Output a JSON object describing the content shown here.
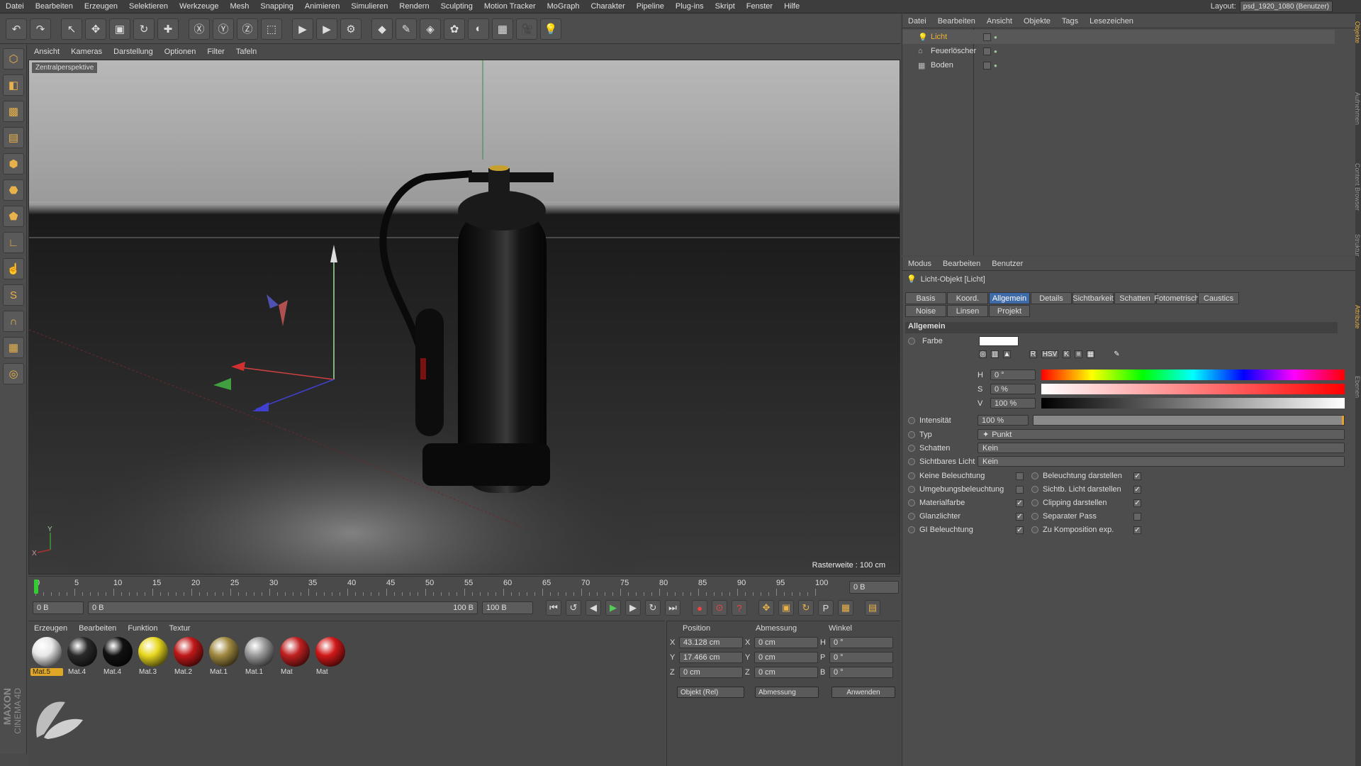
{
  "menu": [
    "Datei",
    "Bearbeiten",
    "Erzeugen",
    "Selektieren",
    "Werkzeuge",
    "Mesh",
    "Snapping",
    "Animieren",
    "Simulieren",
    "Rendern",
    "Sculpting",
    "Motion Tracker",
    "MoGraph",
    "Charakter",
    "Pipeline",
    "Plug-ins",
    "Skript",
    "Fenster",
    "Hilfe"
  ],
  "layout": {
    "label": "Layout:",
    "value": "psd_1920_1080 (Benutzer)"
  },
  "viewport": {
    "menu": [
      "Ansicht",
      "Kameras",
      "Darstellung",
      "Optionen",
      "Filter",
      "Tafeln"
    ],
    "tag": "Zentralperspektive",
    "raster": "Rasterweite : 100 cm",
    "axis_x": "X",
    "axis_y": "Y"
  },
  "timeline": {
    "marks": [
      "0",
      "5",
      "10",
      "15",
      "20",
      "25",
      "30",
      "35",
      "40",
      "45",
      "50",
      "55",
      "60",
      "65",
      "70",
      "75",
      "80",
      "85",
      "90",
      "95",
      "100"
    ],
    "current_frame": "0 B",
    "start": "0 B",
    "range_start": "0 B",
    "range_end": "100 B",
    "end": "100 B"
  },
  "materials": {
    "menu": [
      "Erzeugen",
      "Bearbeiten",
      "Funktion",
      "Textur"
    ],
    "items": [
      {
        "label": "Mat.5",
        "color": "#e8e8e8",
        "selected": true
      },
      {
        "label": "Mat.4",
        "color": "#2a2a2a",
        "selected": false
      },
      {
        "label": "Mat.4",
        "color": "#111111",
        "selected": false
      },
      {
        "label": "Mat.3",
        "color": "#e8d820",
        "selected": false
      },
      {
        "label": "Mat.2",
        "color": "#c01818",
        "selected": false
      },
      {
        "label": "Mat.1",
        "color": "#a08a40",
        "selected": false
      },
      {
        "label": "Mat.1",
        "color": "#9a9a9a",
        "selected": false
      },
      {
        "label": "Mat",
        "color": "#c02020",
        "selected": false
      },
      {
        "label": "Mat",
        "color": "#d01818",
        "selected": false
      }
    ]
  },
  "coords": {
    "headers": [
      "Position",
      "Abmessung",
      "Winkel"
    ],
    "rows": [
      {
        "axis": "X",
        "pos": "43.128 cm",
        "dim_axis": "X",
        "dim": "0 cm",
        "ang_axis": "H",
        "ang": "0 °"
      },
      {
        "axis": "Y",
        "pos": "17.466 cm",
        "dim_axis": "Y",
        "dim": "0 cm",
        "ang_axis": "P",
        "ang": "0 °"
      },
      {
        "axis": "Z",
        "pos": "0 cm",
        "dim_axis": "Z",
        "dim": "0 cm",
        "ang_axis": "B",
        "ang": "0 °"
      }
    ],
    "mode": "Objekt (Rel)",
    "size_mode": "Abmessung",
    "apply": "Anwenden"
  },
  "logo": {
    "brand": "MAXON",
    "product": "CINEMA 4D"
  },
  "object_manager": {
    "menu": [
      "Datei",
      "Bearbeiten",
      "Ansicht",
      "Objekte",
      "Tags",
      "Lesezeichen"
    ],
    "objects": [
      {
        "name": "Licht",
        "selected": true
      },
      {
        "name": "Feuerlöscher",
        "selected": false
      },
      {
        "name": "Boden",
        "selected": false
      }
    ]
  },
  "attributes": {
    "menu": [
      "Modus",
      "Bearbeiten",
      "Benutzer"
    ],
    "title": "Licht-Objekt [Licht]",
    "tabs_row1": [
      "Basis",
      "Koord.",
      "Allgemein",
      "Details",
      "Sichtbarkeit",
      "Schatten",
      "Fotometrisch",
      "Caustics"
    ],
    "tabs_row2": [
      "Noise",
      "Linsen",
      "Projekt"
    ],
    "active_tab": "Allgemein",
    "section": "Allgemein",
    "farbe_label": "Farbe",
    "color_mode": "HSV",
    "h": "0 °",
    "s": "0 %",
    "v": "100 %",
    "intensitaet_label": "Intensität",
    "intensitaet": "100 %",
    "typ_label": "Typ",
    "typ": "Punkt",
    "schatten_label": "Schatten",
    "schatten": "Kein",
    "sichtbares_label": "Sichtbares Licht",
    "sichtbares": "Kein",
    "checks_left": [
      {
        "label": "Keine Beleuchtung",
        "checked": false
      },
      {
        "label": "Umgebungsbeleuchtung",
        "checked": false
      },
      {
        "label": "Materialfarbe",
        "checked": true
      },
      {
        "label": "Glanzlichter",
        "checked": true
      },
      {
        "label": "GI Beleuchtung",
        "checked": true
      }
    ],
    "checks_right": [
      {
        "label": "Beleuchtung darstellen",
        "checked": true
      },
      {
        "label": "Sichtb. Licht darstellen",
        "checked": true
      },
      {
        "label": "Clipping darstellen",
        "checked": true
      },
      {
        "label": "Separater Pass",
        "checked": false
      },
      {
        "label": "Zu Komposition exp.",
        "checked": true
      }
    ]
  },
  "side_tabs": [
    "Objekte",
    "Aufnehmen",
    "Content Browser",
    "Struktur",
    "Attribute",
    "Ebenen"
  ]
}
